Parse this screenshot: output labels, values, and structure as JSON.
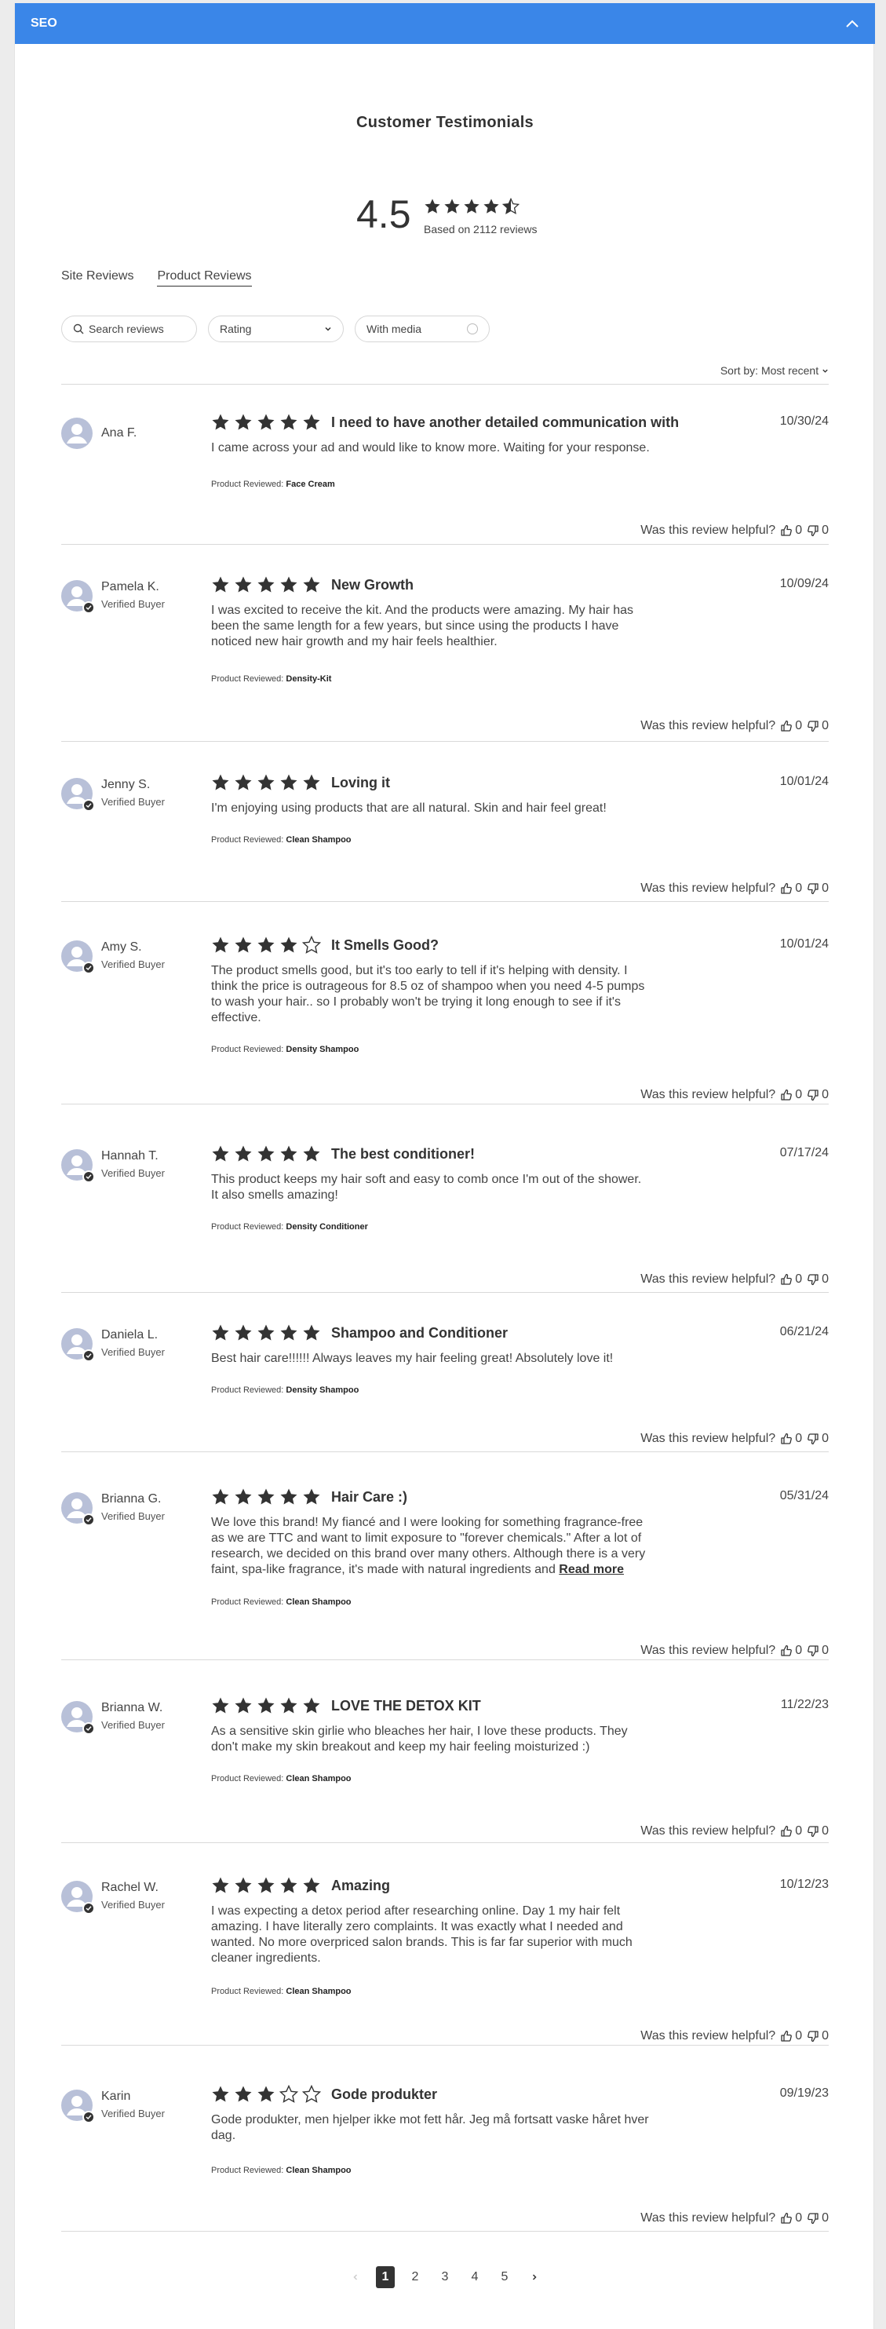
{
  "header": {
    "title": "SEO"
  },
  "section_title": "Customer Testimonials",
  "summary": {
    "average": "4.5",
    "rating": 4.5,
    "based_on": "Based on 2112 reviews"
  },
  "tabs": [
    {
      "label": "Site Reviews",
      "active": false
    },
    {
      "label": "Product Reviews",
      "active": true
    }
  ],
  "filters": {
    "search_placeholder": "Search reviews",
    "rating_label": "Rating",
    "media_label": "With media"
  },
  "sort": {
    "label": "Sort by:",
    "value": "Most recent"
  },
  "helpful_label": "Was this review helpful?",
  "product_label": "Product Reviewed:",
  "read_more": "Read more",
  "verified_label": "Verified Buyer",
  "reviews": [
    {
      "name": "Ana F.",
      "verified": false,
      "rating": 5,
      "title": "I need to have another detailed communication with",
      "date": "10/30/24",
      "body": "I came across your ad and would like to know more. Waiting for your response.",
      "product": "Face Cream",
      "up": "0",
      "down": "0"
    },
    {
      "name": "Pamela K.",
      "verified": true,
      "rating": 5,
      "title": "New Growth",
      "date": "10/09/24",
      "body": "I was excited to receive the kit. And the products were amazing. My hair has been the same length for a few years, but since using the products I have noticed new hair growth and my hair feels healthier.",
      "product": "Density-Kit",
      "up": "0",
      "down": "0"
    },
    {
      "name": "Jenny S.",
      "verified": true,
      "rating": 5,
      "title": "Loving it",
      "date": "10/01/24",
      "body": "I'm enjoying using products that are all natural. Skin and hair feel great!",
      "product": "Clean Shampoo",
      "up": "0",
      "down": "0"
    },
    {
      "name": "Amy S.",
      "verified": true,
      "rating": 4,
      "title": "It Smells Good?",
      "date": "10/01/24",
      "body": "The product smells good, but it's too early to tell if it's helping with density. I think the price is outrageous for 8.5 oz of shampoo when you need 4-5 pumps to wash your hair.. so I probably won't be trying it long enough to see if it's effective.",
      "product": "Density Shampoo",
      "up": "0",
      "down": "0"
    },
    {
      "name": "Hannah T.",
      "verified": true,
      "rating": 5,
      "title": "The best conditioner!",
      "date": "07/17/24",
      "body": "This product keeps my hair soft and easy to comb once I'm out of the shower. It also smells amazing!",
      "product": "Density Conditioner",
      "up": "0",
      "down": "0"
    },
    {
      "name": "Daniela L.",
      "verified": true,
      "rating": 5,
      "title": "Shampoo and Conditioner",
      "date": "06/21/24",
      "body": "Best hair care!!!!!! Always leaves my hair feeling great! Absolutely love it!",
      "product": "Density Shampoo",
      "up": "0",
      "down": "0"
    },
    {
      "name": "Brianna G.",
      "verified": true,
      "rating": 5,
      "title": "Hair Care :)",
      "date": "05/31/24",
      "body": "We love this brand! My fiancé and I were looking for something fragrance-free as we are TTC and want to limit exposure to \"forever chemicals.\" After a lot of research, we decided on this brand over many others. Although there is a very faint, spa-like fragrance, it's made with natural ingredients and",
      "product": "Clean Shampoo",
      "up": "0",
      "down": "0",
      "truncated": true
    },
    {
      "name": "Brianna W.",
      "verified": true,
      "rating": 5,
      "title": "LOVE THE DETOX KIT",
      "date": "11/22/23",
      "body": "As a sensitive skin girlie who bleaches her hair, I love these products. They don't make my skin breakout and keep my hair feeling moisturized :)",
      "product": "Clean Shampoo",
      "up": "0",
      "down": "0"
    },
    {
      "name": "Rachel W.",
      "verified": true,
      "rating": 5,
      "title": "Amazing",
      "date": "10/12/23",
      "body": "I was expecting a detox period after researching online. Day 1 my hair felt amazing. I have literally zero complaints. It was exactly what I needed and wanted. No more overpriced salon brands. This is far far superior with much cleaner ingredients.",
      "product": "Clean Shampoo",
      "up": "0",
      "down": "0"
    },
    {
      "name": "Karin",
      "verified": true,
      "rating": 3,
      "title": "Gode produkter",
      "date": "09/19/23",
      "body": "Gode produkter, men hjelper ikke mot fett hår. Jeg må fortsatt vaske håret hver dag.",
      "product": "Clean Shampoo",
      "up": "0",
      "down": "0"
    }
  ],
  "pagination": {
    "pages": [
      "1",
      "2",
      "3",
      "4",
      "5"
    ],
    "current": "1"
  },
  "colors": {
    "accent": "#3a86e8",
    "star": "#333333",
    "avatar": "#b8c0d8"
  }
}
